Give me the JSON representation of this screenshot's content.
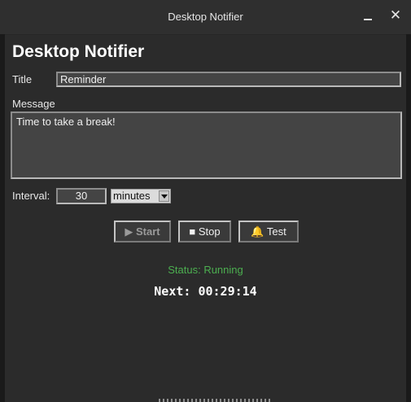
{
  "window": {
    "title": "Desktop Notifier",
    "minimize_icon": "minimize-icon",
    "close_icon": "close-icon",
    "close_glyph": "✕"
  },
  "app": {
    "heading": "Desktop Notifier",
    "title_label": "Title",
    "title_value": "Reminder",
    "message_label": "Message",
    "message_value": "Time to take a break!",
    "interval_label": "Interval:",
    "interval_value": "30",
    "unit_selected": "minutes"
  },
  "buttons": {
    "start_label": "▶ Start",
    "stop_label": "■ Stop",
    "test_label": "🔔 Test"
  },
  "status": {
    "text": "Status: Running",
    "color": "#4caf50",
    "next_text": "Next: 00:29:14"
  }
}
